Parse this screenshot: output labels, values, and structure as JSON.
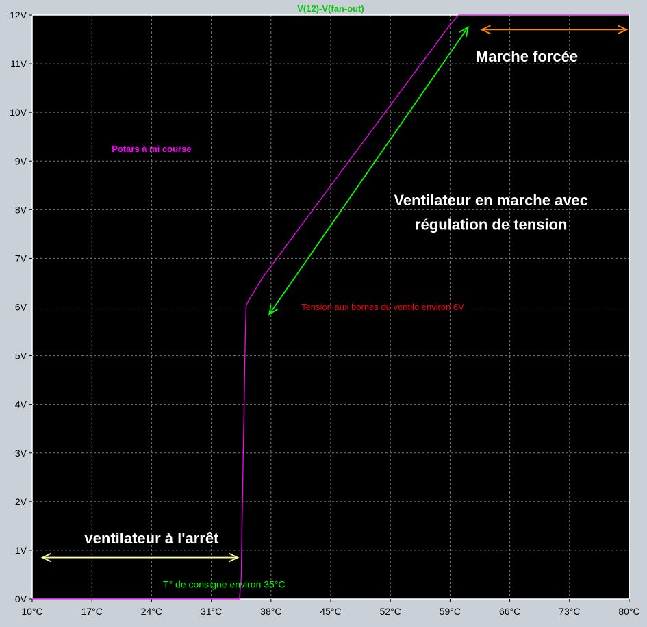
{
  "chart_data": {
    "type": "line",
    "trace_label": "V(12)-V(fan-out)",
    "x_ticks": [
      "10°C",
      "17°C",
      "24°C",
      "31°C",
      "38°C",
      "45°C",
      "52°C",
      "59°C",
      "66°C",
      "73°C",
      "80°C"
    ],
    "y_ticks": [
      "0V",
      "1V",
      "2V",
      "3V",
      "4V",
      "5V",
      "6V",
      "7V",
      "8V",
      "9V",
      "10V",
      "11V",
      "12V"
    ],
    "xlim": [
      10,
      80
    ],
    "ylim": [
      0,
      12
    ],
    "grid": true,
    "series": [
      {
        "color": "#ff00ff",
        "x": [
          10,
          34.3,
          34.5,
          35.0,
          35.1,
          37.0,
          59.0,
          60.0,
          61.0,
          80.0
        ],
        "y": [
          0.0,
          0.0,
          0.4,
          5.5,
          6.05,
          6.6,
          11.8,
          12.0,
          12.0,
          12.0
        ]
      }
    ],
    "annotations": {
      "potars": {
        "text": "Potars à mi course",
        "x": 24,
        "y": 9.25,
        "color": "#ff00ff"
      },
      "regulation_line1": {
        "text": "Ventilateur en marche avec",
        "x": 63.8,
        "y": 8.2,
        "color": "#ffffff"
      },
      "regulation_line2": {
        "text": "régulation de tension",
        "x": 63.8,
        "y": 7.7,
        "color": "#ffffff"
      },
      "marche_forcee": {
        "text": "Marche forcée",
        "x": 68,
        "y": 11.15,
        "color": "#ffffff"
      },
      "tension_ventilo": {
        "text": "Tension aux bornes du ventilo environ 6V",
        "x": 51.1,
        "y": 6.0,
        "color": "#ff0000"
      },
      "arret": {
        "text": "ventilateur à l'arrêt",
        "x": 24,
        "y": 1.25,
        "color": "#ffffff"
      },
      "consigne": {
        "text": "T° de consigne environ 35°C",
        "x": 32.5,
        "y": 0.3,
        "color": "#00ff00"
      }
    },
    "arrows": {
      "arret": {
        "x": [
          11.2,
          34.1
        ],
        "y": [
          0.85,
          0.85
        ],
        "color": "#ffff99"
      },
      "regulation": {
        "x": [
          37.8,
          61.1
        ],
        "y": [
          5.85,
          11.75
        ],
        "color": "#00ff00"
      },
      "forcee": {
        "x": [
          62.7,
          79.7
        ],
        "y": [
          11.7,
          11.7
        ],
        "color": "#ff8800"
      }
    }
  }
}
